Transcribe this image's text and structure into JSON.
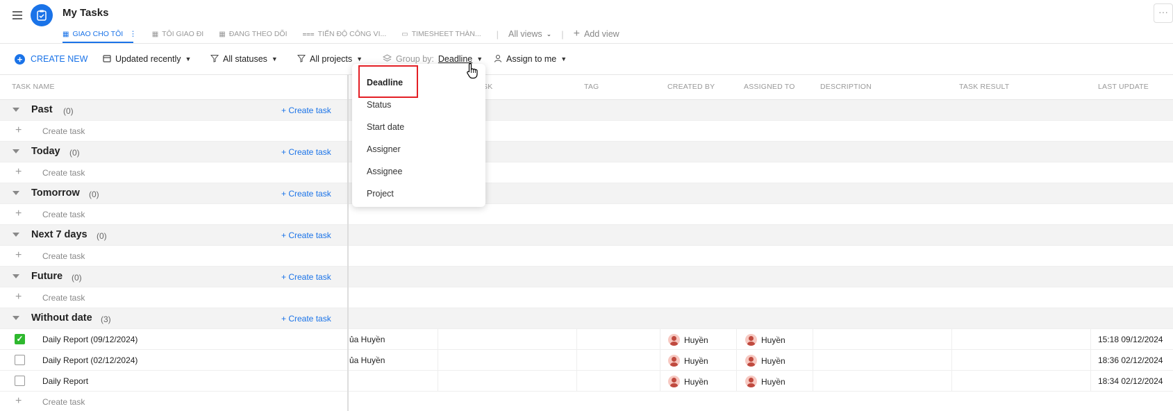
{
  "header": {
    "title": "My Tasks",
    "tabs": [
      {
        "label": "GIAO CHO TÔI",
        "icon": "table-icon",
        "active": true
      },
      {
        "label": "TÔI GIAO ĐI",
        "icon": "table-icon"
      },
      {
        "label": "ĐANG THEO DÕI",
        "icon": "table-icon"
      },
      {
        "label": "TIẾN ĐỘ CÔNG VI...",
        "icon": "gantt-icon"
      },
      {
        "label": "TIMESHEET THÀN...",
        "icon": "calendar-icon"
      }
    ],
    "all_views": "All views",
    "add_view": "Add view"
  },
  "toolbar": {
    "create_new": "CREATE NEW",
    "sort": "Updated recently",
    "status_filter": "All statuses",
    "project_filter": "All projects",
    "group_by_label": "Group by:",
    "group_by_value": "Deadline",
    "assign_filter": "Assign to me"
  },
  "columns": {
    "task_name": "TASK NAME",
    "task_partial": "SK",
    "tag": "TAG",
    "created_by": "CREATED BY",
    "assigned_to": "ASSIGNED TO",
    "description": "DESCRIPTION",
    "task_result": "TASK RESULT",
    "last_update": "LAST UPDATE"
  },
  "groups": [
    {
      "name": "Past",
      "count": "(0)",
      "create": "+ Create task",
      "add_label": "Create task"
    },
    {
      "name": "Today",
      "count": "(0)",
      "create": "+ Create task",
      "add_label": "Create task"
    },
    {
      "name": "Tomorrow",
      "count": "(0)",
      "create": "+ Create task",
      "add_label": "Create task"
    },
    {
      "name": "Next 7 days",
      "count": "(0)",
      "create": "+ Create task",
      "add_label": "Create task"
    },
    {
      "name": "Future",
      "count": "(0)",
      "create": "+ Create task",
      "add_label": "Create task"
    },
    {
      "name": "Without date",
      "count": "(3)",
      "create": "+ Create task",
      "add_label": "Create task"
    }
  ],
  "tasks": [
    {
      "name": "Daily Report (09/12/2024)",
      "checked": true,
      "project": "ủa Huyền",
      "created_by": "Huyền",
      "assigned_to": "Huyền",
      "last_update": "15:18 09/12/2024"
    },
    {
      "name": "Daily Report (02/12/2024)",
      "checked": false,
      "project": "ủa Huyền",
      "created_by": "Huyền",
      "assigned_to": "Huyền",
      "last_update": "18:36 02/12/2024"
    },
    {
      "name": "Daily Report",
      "checked": false,
      "project": "",
      "created_by": "Huyền",
      "assigned_to": "Huyền",
      "last_update": "18:34 02/12/2024"
    }
  ],
  "group_by_menu": {
    "options": [
      "Deadline",
      "Status",
      "Start date",
      "Assigner",
      "Assignee",
      "Project"
    ],
    "selected": "Deadline"
  },
  "colors": {
    "accent": "#1a73e8",
    "highlight": "#e31e24",
    "check": "#2eb82e"
  }
}
